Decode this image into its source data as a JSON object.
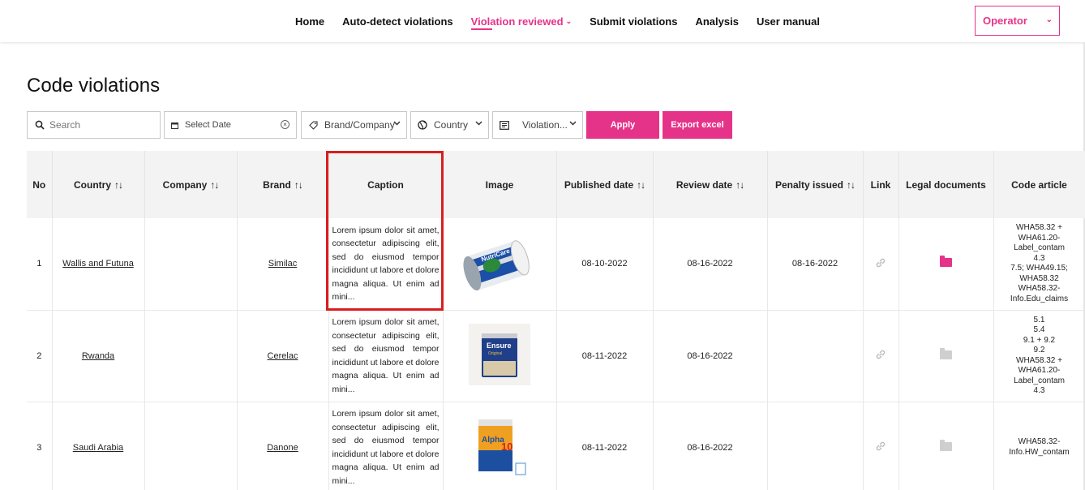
{
  "nav": {
    "items": [
      {
        "label": "Home",
        "active": false,
        "dropdown": false
      },
      {
        "label": "Auto-detect violations",
        "active": false,
        "dropdown": false
      },
      {
        "label": "Violation reviewed",
        "active": true,
        "dropdown": true
      },
      {
        "label": "Submit violations",
        "active": false,
        "dropdown": false
      },
      {
        "label": "Analysis",
        "active": false,
        "dropdown": false
      },
      {
        "label": "User manual",
        "active": false,
        "dropdown": false
      }
    ],
    "role": "Operator"
  },
  "page": {
    "title": "Code violations"
  },
  "filters": {
    "search_placeholder": "Search",
    "date_placeholder": "Select Date",
    "brand_label": "Brand/Company",
    "country_label": "Country",
    "violation_label": "Violation...",
    "apply_label": "Apply",
    "export_label": "Export excel"
  },
  "table": {
    "headers": {
      "no": "No",
      "country": "Country",
      "company": "Company",
      "brand": "Brand",
      "caption": "Caption",
      "image": "Image",
      "published": "Published date",
      "review": "Review date",
      "penalty": "Penalty issued",
      "link": "Link",
      "legal": "Legal documents",
      "code": "Code article"
    },
    "rows": [
      {
        "no": "1",
        "country": "Wallis and Futuna",
        "company": "",
        "brand": "Similac",
        "caption": "Lorem ipsum dolor sit amet, consectetur adipiscing elit, sed do eiusmod tempor incididunt ut labore et dolore magna aliqua. Ut enim ad mini...",
        "image": "can-white-blue",
        "published": "08-10-2022",
        "review": "08-16-2022",
        "penalty": "08-16-2022",
        "code_lines": [
          "WHA58.32 +",
          "WHA61.20-",
          "Label_contam",
          "4.3",
          "7.5; WHA49.15;",
          "WHA58.32",
          "WHA58.32-",
          "Info.Edu_claims"
        ],
        "legal_active": true
      },
      {
        "no": "2",
        "country": "Rwanda",
        "company": "",
        "brand": "Cerelac",
        "caption": "Lorem ipsum dolor sit amet, consectetur adipiscing elit, sed do eiusmod tempor incididunt ut labore et dolore magna aliqua. Ut enim ad mini...",
        "image": "can-ensure",
        "published": "08-11-2022",
        "review": "08-16-2022",
        "penalty": "",
        "code_lines": [
          "5.1",
          "5.4",
          "9.1 + 9.2",
          "9.2",
          "WHA58.32 +",
          "WHA61.20-",
          "Label_contam",
          "4.3"
        ],
        "legal_active": false
      },
      {
        "no": "3",
        "country": "Saudi Arabia",
        "company": "",
        "brand": "Danone",
        "caption": "Lorem ipsum dolor sit amet, consectetur adipiscing elit, sed do eiusmod tempor incididunt ut labore et dolore magna aliqua. Ut enim ad mini...",
        "image": "can-alpha",
        "published": "08-11-2022",
        "review": "08-16-2022",
        "penalty": "",
        "code_lines": [
          "WHA58.32-",
          "Info.HW_contam"
        ],
        "legal_active": false
      }
    ]
  },
  "colors": {
    "accent": "#e6338a",
    "highlight": "#d91e1e"
  }
}
